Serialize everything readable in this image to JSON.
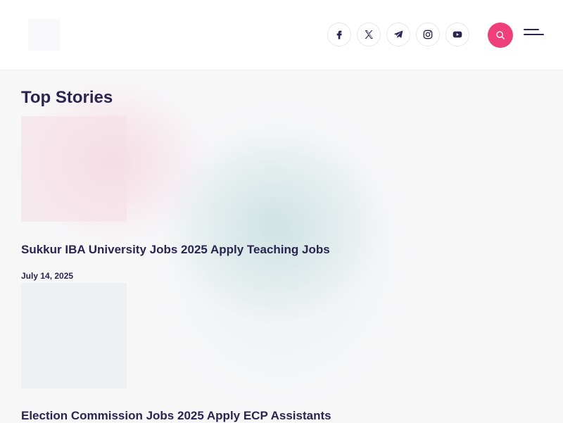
{
  "header": {
    "socials": [
      {
        "name": "facebook-icon"
      },
      {
        "name": "x-icon"
      },
      {
        "name": "telegram-icon"
      },
      {
        "name": "instagram-icon"
      },
      {
        "name": "youtube-icon"
      }
    ],
    "search_icon": "search-icon",
    "menu_icon": "hamburger-menu-icon",
    "accent": "#ee3f7a"
  },
  "main": {
    "section_title": "Top Stories",
    "stories": [
      {
        "title": "Sukkur IBA University Jobs 2025 Apply Teaching Jobs",
        "date": "July 14, 2025"
      },
      {
        "title": "Election Commission Jobs 2025 Apply ECP Assistants"
      }
    ]
  }
}
